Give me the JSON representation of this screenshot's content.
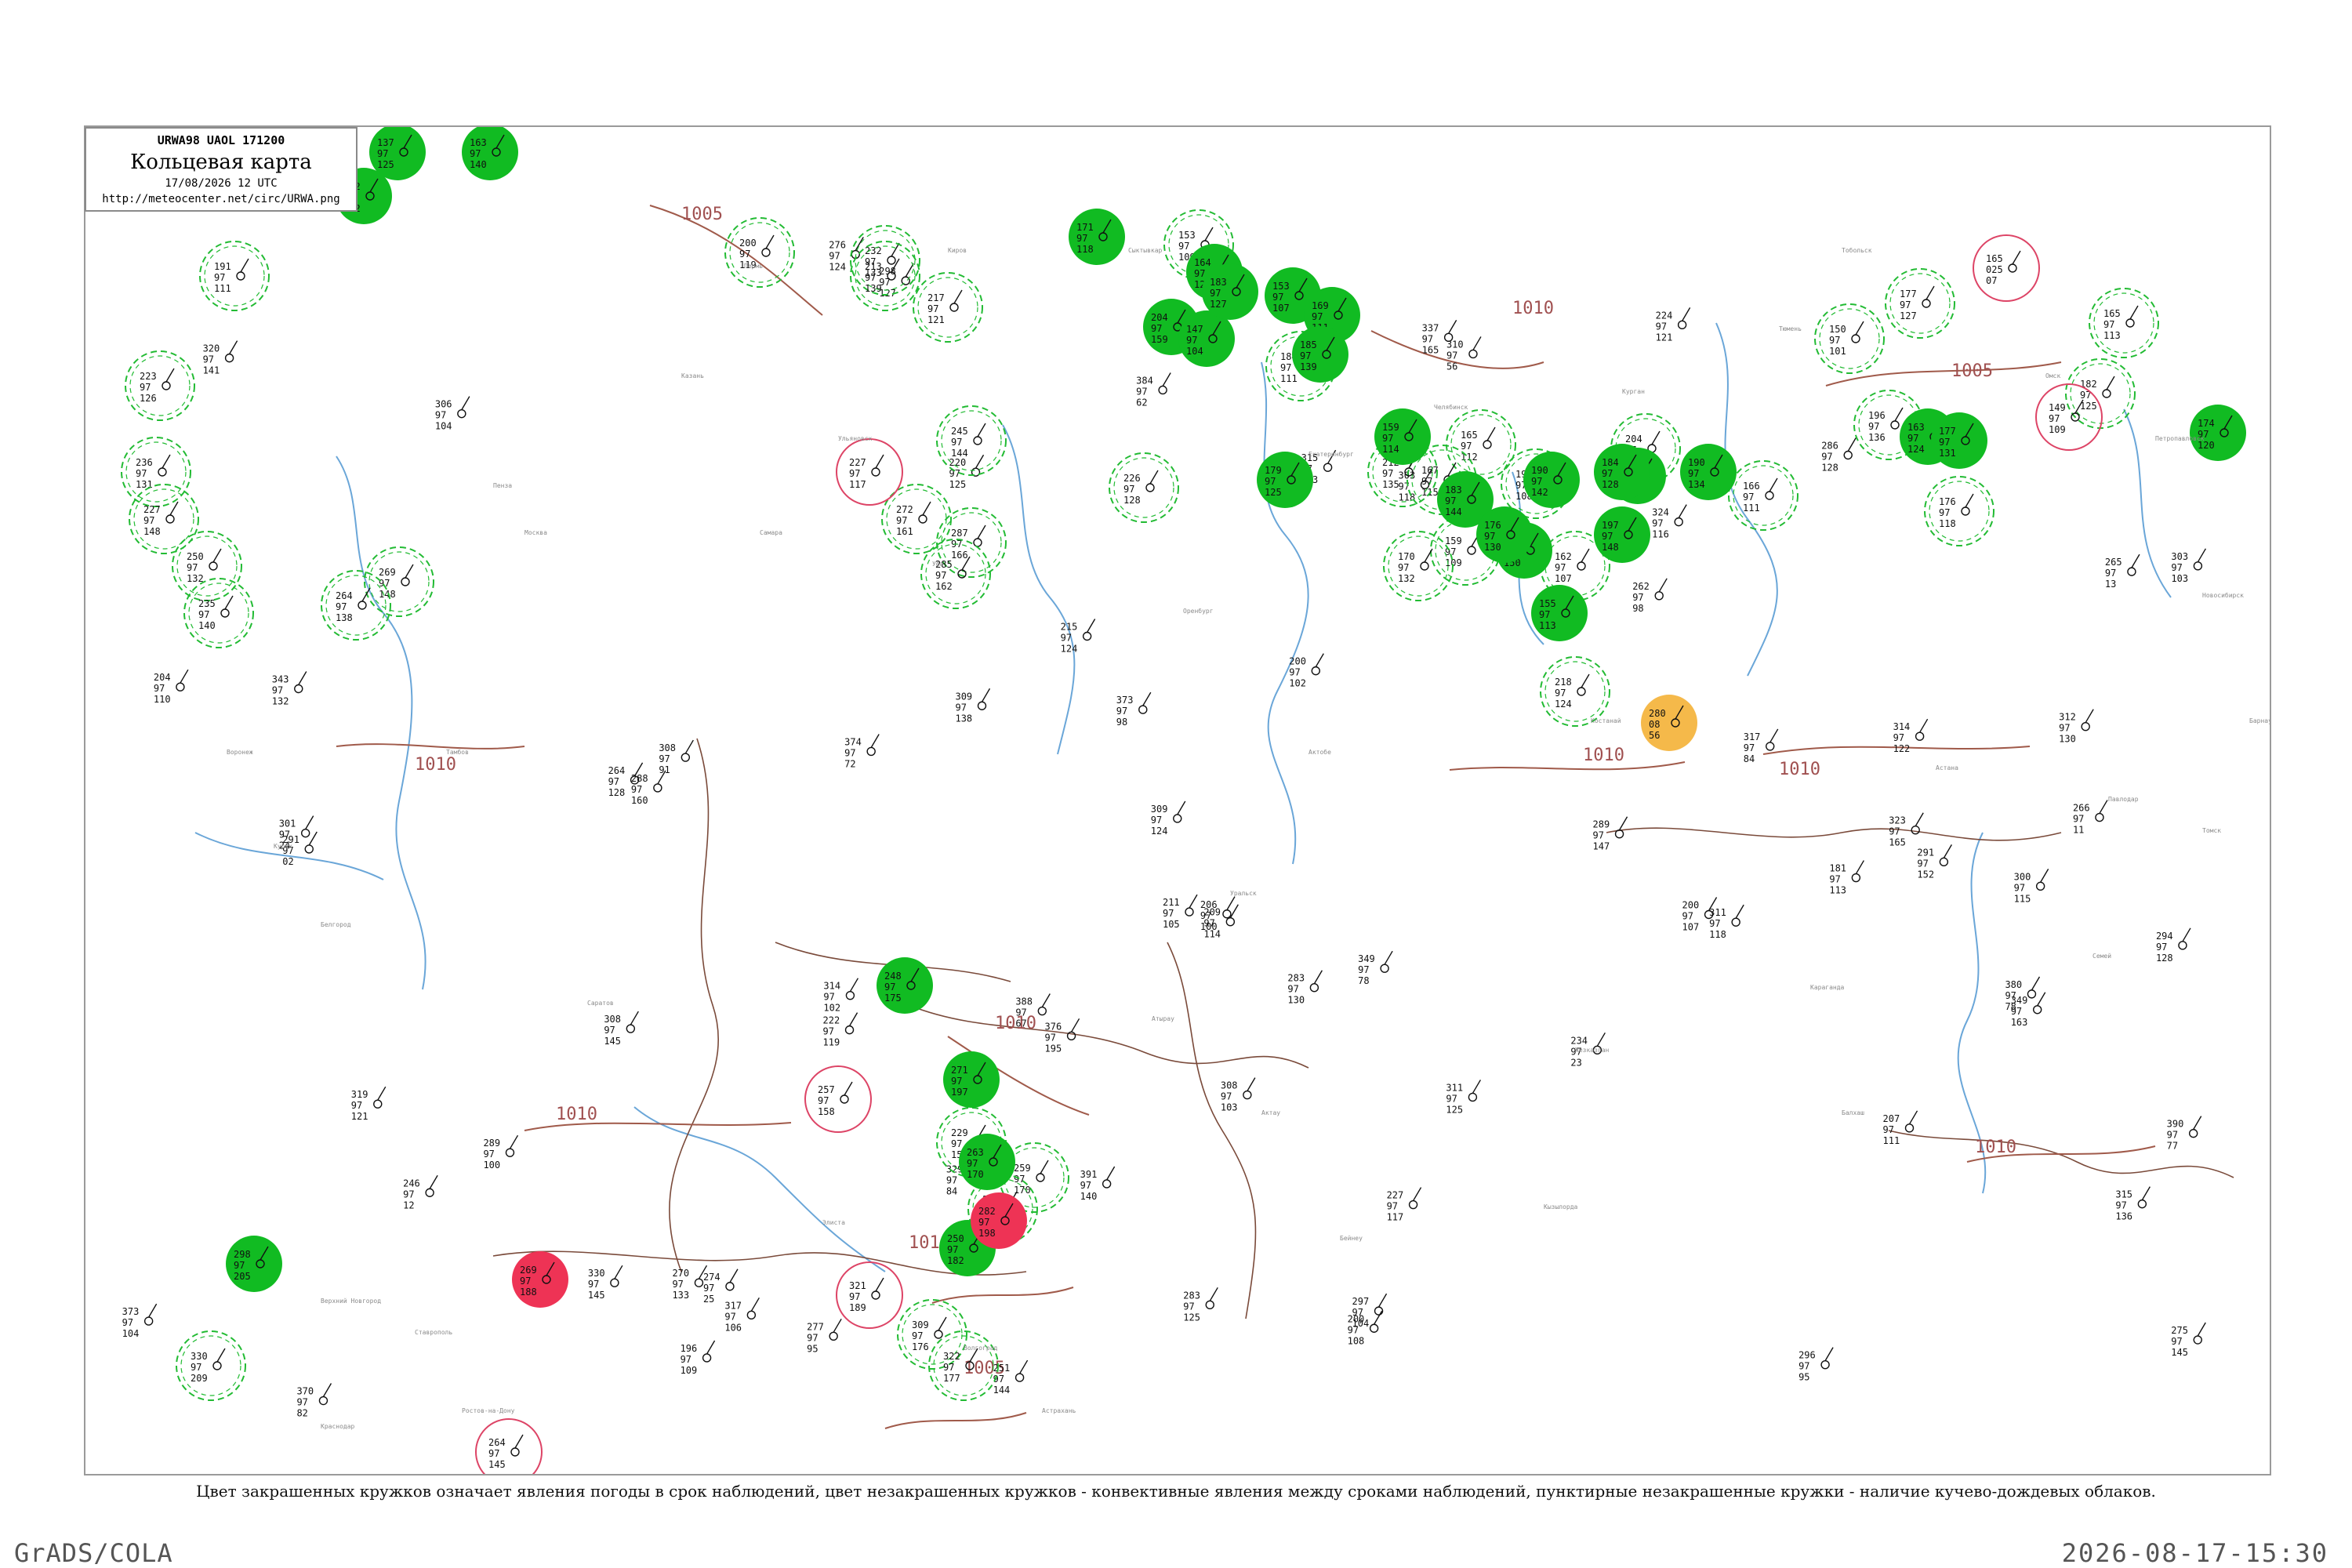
{
  "title_box": {
    "code": "URWA98  UAOL  171200",
    "title": "Кольцевая карта",
    "date": "17/08/2026 12 UTC",
    "url": "http://meteocenter.net/circ/URWA.png"
  },
  "legend_note": "Цвет закрашенных кружков означает явления погоды в срок наблюдений, цвет незакрашенных кружков - конвективные явления между сроками наблюдений, пунктирные незакрашенные кружки - наличие кучево-дождевых облаков.",
  "footer": {
    "left": "GrADS/COLA",
    "right": "2026-08-17-15:30"
  },
  "colors": {
    "filled_green": "#11bb22",
    "filled_red": "#ee3355",
    "filled_orange": "#f5b94a",
    "dashed_green": "#22bb33",
    "ring_red": "#dd4466",
    "isobar": "#a05a4a",
    "river": "#6aa6d8",
    "border": "#7a4a3a"
  },
  "isobars": [
    {
      "label": "1005",
      "near": "top-center"
    },
    {
      "label": "1010",
      "near": "center-right"
    },
    {
      "label": "1005",
      "near": "upper-right"
    },
    {
      "label": "1010",
      "near": "left"
    },
    {
      "label": "1010",
      "near": "right"
    },
    {
      "label": "1010",
      "near": "center"
    },
    {
      "label": "1010",
      "near": "lower-center"
    },
    {
      "label": "1010",
      "near": "lower-left"
    },
    {
      "label": "1010",
      "near": "lower-right"
    },
    {
      "label": "1005",
      "near": "bottom-center"
    },
    {
      "label": "1010",
      "near": "bottom-center-left"
    }
  ],
  "filled_stations": [
    {
      "kind": "green",
      "top": "137",
      "mid": "97",
      "bot": "125"
    },
    {
      "kind": "green",
      "top": "163",
      "mid": "97",
      "bot": "140"
    },
    {
      "kind": "green",
      "top": "222",
      "mid": "97",
      "bot": "152"
    },
    {
      "kind": "green",
      "top": "171",
      "mid": "97",
      "bot": "118"
    },
    {
      "kind": "green",
      "top": "204",
      "mid": "97",
      "bot": "159"
    },
    {
      "kind": "green",
      "top": "164",
      "mid": "97",
      "bot": "122"
    },
    {
      "kind": "green",
      "top": "153",
      "mid": "97",
      "bot": "107"
    },
    {
      "kind": "green",
      "top": "169",
      "mid": "97",
      "bot": "111"
    },
    {
      "kind": "green",
      "top": "185",
      "mid": "97",
      "bot": "139"
    },
    {
      "kind": "green",
      "top": "159",
      "mid": "97",
      "bot": "114"
    },
    {
      "kind": "green",
      "top": "147",
      "mid": "97",
      "bot": "104"
    },
    {
      "kind": "green",
      "top": "183",
      "mid": "97",
      "bot": "144"
    },
    {
      "kind": "green",
      "top": "198",
      "mid": "97",
      "bot": "150"
    },
    {
      "kind": "green",
      "top": "176",
      "mid": "97",
      "bot": "130"
    },
    {
      "kind": "green",
      "top": "136",
      "mid": "97",
      "bot": "93"
    },
    {
      "kind": "green",
      "top": "190",
      "mid": "97",
      "bot": "142"
    },
    {
      "kind": "green",
      "top": "179",
      "mid": "97",
      "bot": "125"
    },
    {
      "kind": "green",
      "top": "183",
      "mid": "97",
      "bot": "127"
    },
    {
      "kind": "green",
      "top": "197",
      "mid": "97",
      "bot": "148"
    },
    {
      "kind": "green",
      "top": "190",
      "mid": "97",
      "bot": "134"
    },
    {
      "kind": "green",
      "top": "163",
      "mid": "97",
      "bot": "124"
    },
    {
      "kind": "green",
      "top": "177",
      "mid": "97",
      "bot": "131"
    },
    {
      "kind": "green",
      "top": "184",
      "mid": "97",
      "bot": "128"
    },
    {
      "kind": "green",
      "top": "174",
      "mid": "97",
      "bot": "120"
    },
    {
      "kind": "green",
      "top": "155",
      "mid": "97",
      "bot": "113"
    },
    {
      "kind": "green",
      "top": "248",
      "mid": "97",
      "bot": "175"
    },
    {
      "kind": "green",
      "top": "271",
      "mid": "97",
      "bot": "197"
    },
    {
      "kind": "green",
      "top": "263",
      "mid": "97",
      "bot": "170"
    },
    {
      "kind": "green",
      "top": "250",
      "mid": "97",
      "bot": "182"
    },
    {
      "kind": "green",
      "top": "298",
      "mid": "97",
      "bot": "205"
    },
    {
      "kind": "orange",
      "top": "280",
      "mid": "08",
      "bot": "56"
    },
    {
      "kind": "red",
      "top": "282",
      "mid": "97",
      "bot": "198"
    },
    {
      "kind": "red",
      "top": "269",
      "mid": "97",
      "bot": "188"
    }
  ],
  "outline_stations": [
    {
      "kind": "dashed",
      "top": "223",
      "mid": "97",
      "bot": "126"
    },
    {
      "kind": "dashed",
      "top": "191",
      "mid": "97",
      "bot": "111"
    },
    {
      "kind": "dashed",
      "top": "236",
      "mid": "97",
      "bot": "131"
    },
    {
      "kind": "dashed",
      "top": "227",
      "mid": "97",
      "bot": "148"
    },
    {
      "kind": "dashed",
      "top": "250",
      "mid": "97",
      "bot": "132"
    },
    {
      "kind": "dashed",
      "top": "235",
      "mid": "97",
      "bot": "140"
    },
    {
      "kind": "dashed",
      "top": "269",
      "mid": "97",
      "bot": "148"
    },
    {
      "kind": "dashed",
      "top": "264",
      "mid": "97",
      "bot": "138"
    },
    {
      "kind": "dashed",
      "top": "200",
      "mid": "97",
      "bot": "119"
    },
    {
      "kind": "dashed",
      "top": "232",
      "mid": "97",
      "bot": "133"
    },
    {
      "kind": "dashed",
      "top": "213",
      "mid": "97",
      "bot": "139"
    },
    {
      "kind": "dashed",
      "top": "217",
      "mid": "97",
      "bot": "121"
    },
    {
      "kind": "dashed",
      "top": "245",
      "mid": "97",
      "bot": "144"
    },
    {
      "kind": "dashed",
      "top": "272",
      "mid": "97",
      "bot": "161"
    },
    {
      "kind": "dashed",
      "top": "287",
      "mid": "97",
      "bot": "166"
    },
    {
      "kind": "dashed",
      "top": "285",
      "mid": "97",
      "bot": "162"
    },
    {
      "kind": "dashed",
      "top": "153",
      "mid": "97",
      "bot": "109"
    },
    {
      "kind": "dashed",
      "top": "184",
      "mid": "97",
      "bot": "111"
    },
    {
      "kind": "dashed",
      "top": "165",
      "mid": "97",
      "bot": "112"
    },
    {
      "kind": "dashed",
      "top": "167",
      "mid": "97",
      "bot": "115"
    },
    {
      "kind": "dashed",
      "top": "159",
      "mid": "97",
      "bot": "109"
    },
    {
      "kind": "dashed",
      "top": "162",
      "mid": "97",
      "bot": "107"
    },
    {
      "kind": "dashed",
      "top": "166",
      "mid": "97",
      "bot": "111"
    },
    {
      "kind": "dashed",
      "top": "177",
      "mid": "97",
      "bot": "127"
    },
    {
      "kind": "dashed",
      "top": "196",
      "mid": "97",
      "bot": "136"
    },
    {
      "kind": "dashed",
      "top": "176",
      "mid": "97",
      "bot": "118"
    },
    {
      "kind": "dashed",
      "top": "150",
      "mid": "97",
      "bot": "101"
    },
    {
      "kind": "dashed",
      "top": "182",
      "mid": "97",
      "bot": "125"
    },
    {
      "kind": "dashed",
      "top": "229",
      "mid": "97",
      "bot": "150"
    },
    {
      "kind": "dashed",
      "top": "259",
      "mid": "97",
      "bot": "170"
    },
    {
      "kind": "dashed",
      "top": "330",
      "mid": "97",
      "bot": "209"
    },
    {
      "kind": "dashed",
      "top": "309",
      "mid": "97",
      "bot": "176"
    },
    {
      "kind": "dashed",
      "top": "322",
      "mid": "97",
      "bot": "177"
    },
    {
      "kind": "dashed",
      "top": "252",
      "mid": "97",
      "bot": "152"
    },
    {
      "kind": "dashed",
      "top": "212",
      "mid": "97",
      "bot": "135"
    },
    {
      "kind": "dashed",
      "top": "226",
      "mid": "97",
      "bot": "128"
    },
    {
      "kind": "dashed",
      "top": "191",
      "mid": "97",
      "bot": "108"
    },
    {
      "kind": "dashed",
      "top": "218",
      "mid": "97",
      "bot": "124"
    },
    {
      "kind": "dashed",
      "top": "354",
      "mid": "97",
      "bot": "147"
    },
    {
      "kind": "dashed",
      "top": "165",
      "mid": "97",
      "bot": "113"
    },
    {
      "kind": "dashed",
      "top": "204",
      "mid": "97",
      "bot": "122"
    },
    {
      "kind": "dashed",
      "top": "170",
      "mid": "97",
      "bot": "132"
    },
    {
      "kind": "ring",
      "top": "165",
      "mid": "025",
      "bot": "07"
    },
    {
      "kind": "ring",
      "top": "149",
      "mid": "97",
      "bot": "109"
    },
    {
      "kind": "ring",
      "top": "227",
      "mid": "97",
      "bot": "117"
    },
    {
      "kind": "ring",
      "top": "257",
      "mid": "97",
      "bot": "158"
    },
    {
      "kind": "ring",
      "top": "264",
      "mid": "97",
      "bot": "145"
    },
    {
      "kind": "ring",
      "top": "321",
      "mid": "97",
      "bot": "189"
    }
  ],
  "plain_stations": [
    {
      "top": "224",
      "mid": "97",
      "bot": "121"
    },
    {
      "top": "200",
      "mid": "97",
      "bot": "102"
    },
    {
      "top": "215",
      "mid": "97",
      "bot": "124"
    },
    {
      "top": "196",
      "mid": "97",
      "bot": "109"
    },
    {
      "top": "181",
      "mid": "97",
      "bot": "113"
    },
    {
      "top": "200",
      "mid": "97",
      "bot": "107"
    },
    {
      "top": "211",
      "mid": "97",
      "bot": "105"
    },
    {
      "top": "209",
      "mid": "97",
      "bot": "114"
    },
    {
      "top": "206",
      "mid": "97",
      "bot": "100"
    },
    {
      "top": "204",
      "mid": "97",
      "bot": "110"
    },
    {
      "top": "200",
      "mid": "97",
      "bot": "108"
    },
    {
      "top": "227",
      "mid": "97",
      "bot": "117"
    },
    {
      "top": "220",
      "mid": "97",
      "bot": "125"
    },
    {
      "top": "207",
      "mid": "97",
      "bot": "111"
    },
    {
      "top": "222",
      "mid": "97",
      "bot": "119"
    },
    {
      "top": "251",
      "mid": "97",
      "bot": "144"
    },
    {
      "top": "264",
      "mid": "97",
      "bot": "128"
    },
    {
      "top": "275",
      "mid": "97",
      "bot": "145"
    },
    {
      "top": "289",
      "mid": "97",
      "bot": "147"
    },
    {
      "top": "291",
      "mid": "97",
      "bot": "152"
    },
    {
      "top": "323",
      "mid": "97",
      "bot": "165"
    },
    {
      "top": "320",
      "mid": "97",
      "bot": "141"
    },
    {
      "top": "337",
      "mid": "97",
      "bot": "165"
    },
    {
      "top": "312",
      "mid": "97",
      "bot": "130"
    },
    {
      "top": "330",
      "mid": "97",
      "bot": "145"
    },
    {
      "top": "311",
      "mid": "97",
      "bot": "118"
    },
    {
      "top": "306",
      "mid": "97",
      "bot": "104"
    },
    {
      "top": "300",
      "mid": "97",
      "bot": "115"
    },
    {
      "top": "289",
      "mid": "97",
      "bot": "100"
    },
    {
      "top": "276",
      "mid": "97",
      "bot": "124"
    },
    {
      "top": "283",
      "mid": "97",
      "bot": "130"
    },
    {
      "top": "298",
      "mid": "97",
      "bot": "127"
    },
    {
      "top": "309",
      "mid": "97",
      "bot": "138"
    },
    {
      "top": "315",
      "mid": "97",
      "bot": "133"
    },
    {
      "top": "319",
      "mid": "97",
      "bot": "121"
    },
    {
      "top": "311",
      "mid": "97",
      "bot": "125"
    },
    {
      "top": "315",
      "mid": "97",
      "bot": "136"
    },
    {
      "top": "288",
      "mid": "97",
      "bot": "160"
    },
    {
      "top": "308",
      "mid": "97",
      "bot": "91"
    },
    {
      "top": "317",
      "mid": "97",
      "bot": "84"
    },
    {
      "top": "314",
      "mid": "97",
      "bot": "122"
    },
    {
      "top": "310",
      "mid": "97",
      "bot": "56"
    },
    {
      "top": "301",
      "mid": "97",
      "bot": "24"
    },
    {
      "top": "309",
      "mid": "97",
      "bot": "124"
    },
    {
      "top": "296",
      "mid": "97",
      "bot": "95"
    },
    {
      "top": "324",
      "mid": "97",
      "bot": "116"
    },
    {
      "top": "370",
      "mid": "97",
      "bot": "82"
    },
    {
      "top": "388",
      "mid": "97",
      "bot": "67"
    },
    {
      "top": "390",
      "mid": "97",
      "bot": "77"
    },
    {
      "top": "380",
      "mid": "97",
      "bot": "78"
    },
    {
      "top": "373",
      "mid": "97",
      "bot": "98"
    },
    {
      "top": "374",
      "mid": "97",
      "bot": "72"
    },
    {
      "top": "384",
      "mid": "97",
      "bot": "62"
    },
    {
      "top": "343",
      "mid": "97",
      "bot": "132"
    },
    {
      "top": "349",
      "mid": "97",
      "bot": "163"
    },
    {
      "top": "317",
      "mid": "97",
      "bot": "106"
    },
    {
      "top": "314",
      "mid": "97",
      "bot": "102"
    },
    {
      "top": "303",
      "mid": "97",
      "bot": "118"
    },
    {
      "top": "297",
      "mid": "97",
      "bot": "104"
    },
    {
      "top": "283",
      "mid": "97",
      "bot": "125"
    },
    {
      "top": "274",
      "mid": "97",
      "bot": "25"
    },
    {
      "top": "266",
      "mid": "97",
      "bot": "11"
    },
    {
      "top": "265",
      "mid": "97",
      "bot": "13"
    },
    {
      "top": "246",
      "mid": "97",
      "bot": "12"
    },
    {
      "top": "234",
      "mid": "97",
      "bot": "23"
    },
    {
      "top": "291",
      "mid": "97",
      "bot": "02"
    },
    {
      "top": "303",
      "mid": "97",
      "bot": "103"
    },
    {
      "top": "308",
      "mid": "97",
      "bot": "103"
    },
    {
      "top": "329",
      "mid": "97",
      "bot": "84"
    },
    {
      "top": "349",
      "mid": "97",
      "bot": "78"
    },
    {
      "top": "376",
      "mid": "97",
      "bot": "195"
    },
    {
      "top": "391",
      "mid": "97",
      "bot": "140"
    },
    {
      "top": "373",
      "mid": "97",
      "bot": "104"
    },
    {
      "top": "262",
      "mid": "97",
      "bot": "98"
    },
    {
      "top": "277",
      "mid": "97",
      "bot": "95"
    },
    {
      "top": "308",
      "mid": "97",
      "bot": "145"
    },
    {
      "top": "286",
      "mid": "97",
      "bot": "128"
    },
    {
      "top": "294",
      "mid": "97",
      "bot": "128"
    },
    {
      "top": "270",
      "mid": "97",
      "bot": "133"
    }
  ],
  "place_names": [
    "Верхний Новгород",
    "Москва",
    "Оренбург",
    "Казань",
    "Уфа",
    "Пермь",
    "Самара",
    "Саратов",
    "Волгоград",
    "Астрахань",
    "Элиста",
    "Ставрополь",
    "Краснодар",
    "Ростов-на-Дону",
    "Воронеж",
    "Курск",
    "Белгород",
    "Тамбов",
    "Пенза",
    "Ульяновск",
    "Киров",
    "Сыктывкар",
    "Екатеринбург",
    "Челябинск",
    "Курган",
    "Тюмень",
    "Тобольск",
    "Омск",
    "Петропавловск",
    "Костанай",
    "Актобе",
    "Уральск",
    "Атырау",
    "Актау",
    "Бейнеу",
    "Кызылорда",
    "Караганда",
    "Астана",
    "Павлодар",
    "Семей",
    "Балхаш",
    "Жезказган",
    "Новосибирск",
    "Барнаул",
    "Томск"
  ]
}
